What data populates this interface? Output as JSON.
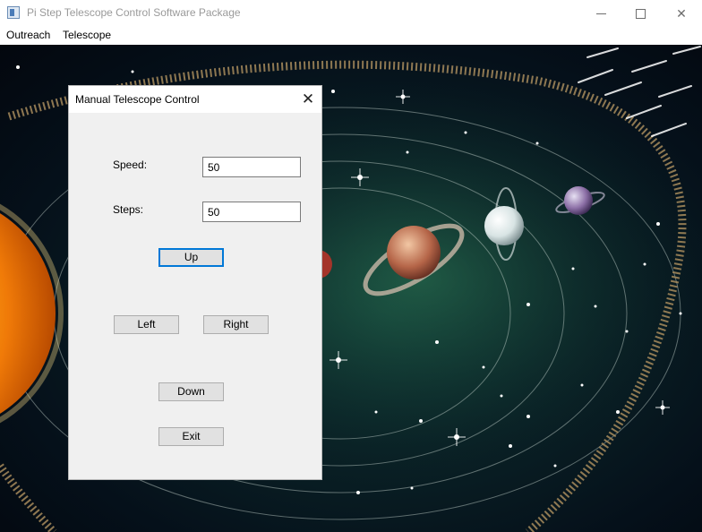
{
  "window": {
    "title": "Pi Step Telescope Control Software Package",
    "controls": {
      "minimize": "minimize",
      "maximize": "maximize",
      "close": "✕"
    }
  },
  "menu": {
    "items": [
      "Outreach",
      "Telescope"
    ]
  },
  "background": {
    "description_icon": "solar-system-wallpaper"
  },
  "dialog": {
    "title": "Manual Telescope Control",
    "close_glyph": "✕",
    "speed_label": "Speed:",
    "speed_value": "50",
    "steps_label": "Steps:",
    "steps_value": "50",
    "buttons": {
      "up": "Up",
      "left": "Left",
      "right": "Right",
      "down": "Down",
      "exit": "Exit"
    }
  },
  "colors": {
    "accent": "#0078d7",
    "dialog_bg": "#f0f0f0",
    "button_bg": "#e1e1e1"
  }
}
